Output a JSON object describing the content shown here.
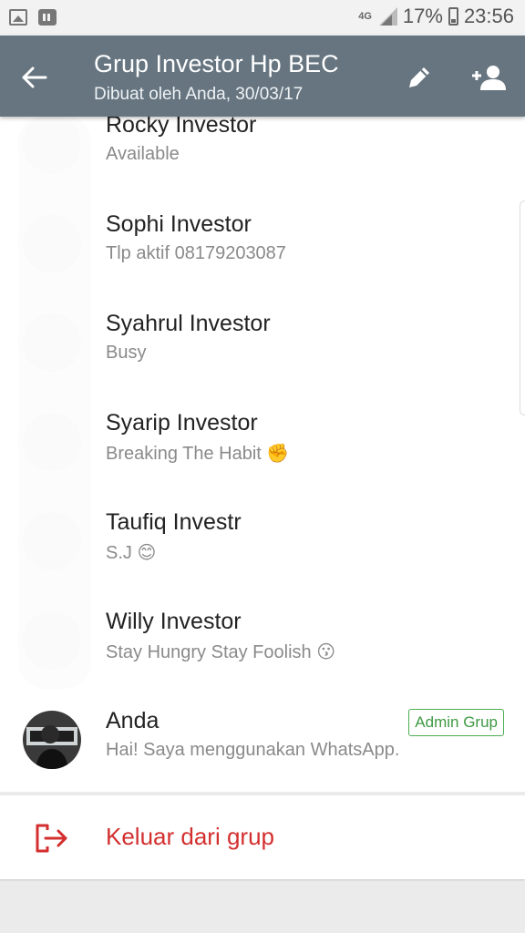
{
  "status_bar": {
    "network": "4G",
    "battery_percent": "17%",
    "time": "23:56"
  },
  "appbar": {
    "title": "Grup Investor Hp BEC",
    "subtitle": "Dibuat oleh Anda, 30/03/17",
    "icons": {
      "back": "arrow-left-icon",
      "edit": "pencil-icon",
      "add": "add-person-icon"
    }
  },
  "participants": [
    {
      "name": "Rocky Investor",
      "status": "Available"
    },
    {
      "name": "Sophi Investor",
      "status": "Tlp aktif 08179203087"
    },
    {
      "name": "Syahrul Investor",
      "status": "Busy"
    },
    {
      "name": "Syarip Investor",
      "status": "Breaking The Habit",
      "emoji": "✊"
    },
    {
      "name": "Taufiq Investr",
      "status": "S.J",
      "emoji": "😊"
    },
    {
      "name": "Willy Investor",
      "status": "Stay Hungry Stay Foolish",
      "emoji": "😗"
    },
    {
      "name": "Anda",
      "status": "Hai! Saya menggunakan WhatsApp.",
      "badge": "Admin Grup"
    }
  ],
  "exit": {
    "label": "Keluar dari grup",
    "icon": "exit-icon"
  },
  "colors": {
    "appbar": "#667580",
    "admin_badge": "#4caf50",
    "exit": "#d32f2f"
  }
}
